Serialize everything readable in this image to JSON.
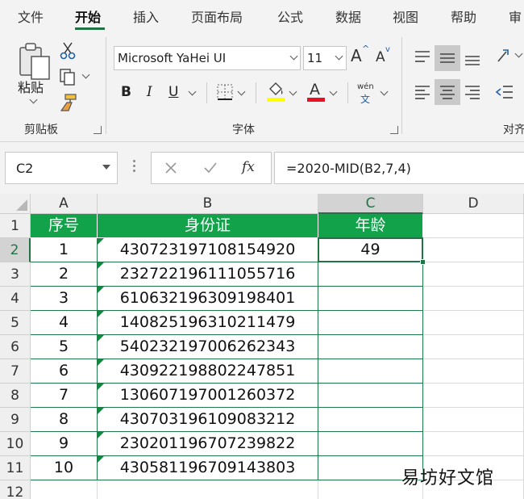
{
  "menu": {
    "items": [
      "文件",
      "开始",
      "插入",
      "页面布局",
      "公式",
      "数据",
      "视图",
      "帮助",
      "审"
    ],
    "active_index": 1
  },
  "ribbon": {
    "clipboard": {
      "paste_label": "粘贴",
      "group_label": "剪贴板"
    },
    "font": {
      "font_name": "Microsoft YaHei UI",
      "font_size": "11",
      "grow_label": "A",
      "shrink_label": "A",
      "bold_label": "B",
      "italic_label": "I",
      "underline_label": "U",
      "font_color_label": "A",
      "phonetic_top": "wén",
      "phonetic_bottom": "文",
      "group_label": "字体",
      "fill_color": "#ffff00",
      "font_color": "#e81123"
    },
    "alignment": {
      "group_label": "对齐"
    }
  },
  "formula_bar": {
    "name_box": "C2",
    "cancel_icon": "close-icon",
    "enter_icon": "check-icon",
    "fx_label": "fx",
    "formula": "=2020-MID(B2,7,4)"
  },
  "sheet": {
    "columns": [
      "A",
      "B",
      "C",
      "D"
    ],
    "rows": [
      "1",
      "2",
      "3",
      "4",
      "5",
      "6",
      "7",
      "8",
      "9",
      "10",
      "11",
      "12"
    ],
    "header_row": [
      "序号",
      "身份证",
      "年龄"
    ],
    "data": [
      [
        "1",
        "430723197108154920",
        "49"
      ],
      [
        "2",
        "232722196111055716",
        ""
      ],
      [
        "3",
        "610632196309198401",
        ""
      ],
      [
        "4",
        "140825196310211479",
        ""
      ],
      [
        "5",
        "540232197006262343",
        ""
      ],
      [
        "6",
        "430922198802247851",
        ""
      ],
      [
        "7",
        "130607197001260372",
        ""
      ],
      [
        "8",
        "430703196109083212",
        ""
      ],
      [
        "9",
        "230201196707239822",
        ""
      ],
      [
        "10",
        "430581196709143803",
        ""
      ]
    ],
    "selected_cell": "C2",
    "header_fill": "#12a34a",
    "accent": "#217346"
  },
  "watermark": "易坊好文馆"
}
